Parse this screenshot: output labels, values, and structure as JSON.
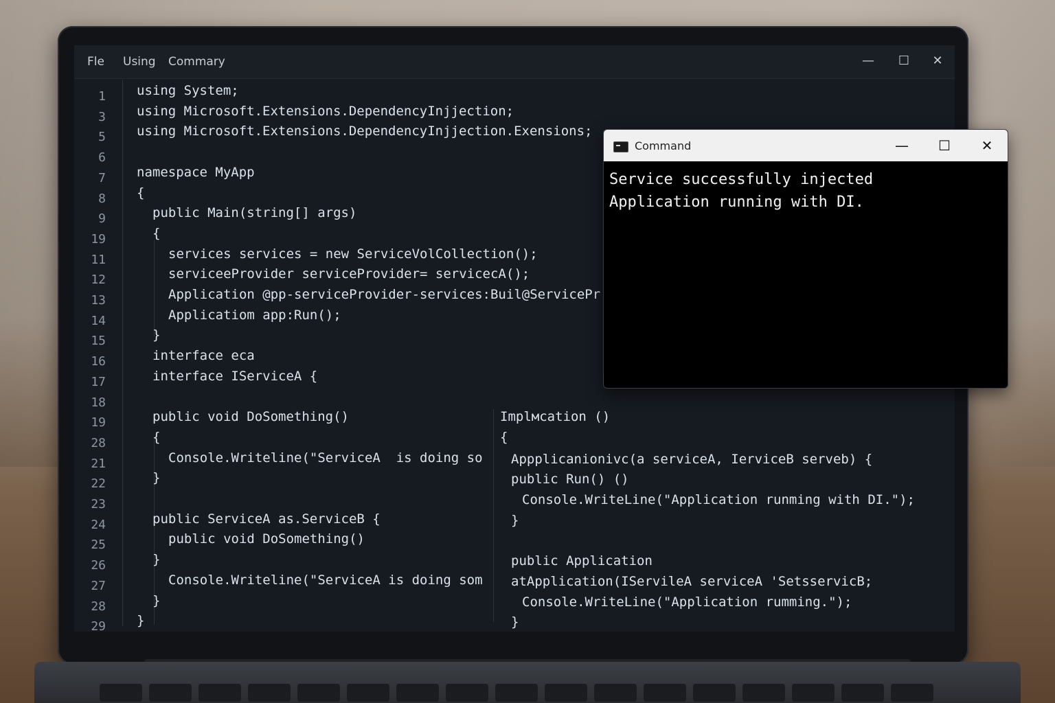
{
  "editor": {
    "menu": [
      "Fle",
      "Using",
      "Commary"
    ],
    "window_controls": [
      "minimize",
      "maximize",
      "close"
    ],
    "line_numbers": [
      "1",
      "3",
      "5",
      "6",
      "7",
      "8",
      "9",
      "19",
      "11",
      "12",
      "13",
      "14",
      "15",
      "16",
      "17",
      "18",
      "19",
      "28",
      "21",
      "22",
      "23",
      "24",
      "25",
      "26",
      "27",
      "28",
      "29"
    ],
    "left_code": [
      {
        "indent": 0,
        "text": "using System;"
      },
      {
        "indent": 0,
        "text": "using Microsoft.Extensions.DependencyInjjection;"
      },
      {
        "indent": 0,
        "text": "using Microsoft.Extensions.DependencyInjjection.Exensions;"
      },
      {
        "indent": 0,
        "text": ""
      },
      {
        "indent": 0,
        "text": "namespace MyApp"
      },
      {
        "indent": 0,
        "text": "{"
      },
      {
        "indent": 1,
        "text": "public Main(string[] args)"
      },
      {
        "indent": 1,
        "text": "{"
      },
      {
        "indent": 2,
        "text": "services services = new ServiceVolCollection();"
      },
      {
        "indent": 2,
        "text": "serviceeProvider serviceProvider= servicecA();"
      },
      {
        "indent": 2,
        "text": "Application @pp-serviceProvider-services:Buil@ServicePr"
      },
      {
        "indent": 2,
        "text": "Applicatiom app:Run();"
      },
      {
        "indent": 1,
        "text": "}"
      },
      {
        "indent": 1,
        "text": "interface eca"
      },
      {
        "indent": 1,
        "text": "interface IServiceA {"
      },
      {
        "indent": 0,
        "text": ""
      },
      {
        "indent": 1,
        "text": "public void DoSomething()"
      },
      {
        "indent": 1,
        "text": "{"
      },
      {
        "indent": 2,
        "text": "Console.Writeline(\"ServiceA  is doing so"
      },
      {
        "indent": 1,
        "text": "}"
      },
      {
        "indent": 0,
        "text": ""
      },
      {
        "indent": 1,
        "text": "public ServiceA as.ServiceB {"
      },
      {
        "indent": 2,
        "text": "public void DoSomething()"
      },
      {
        "indent": 1,
        "text": "}"
      },
      {
        "indent": 2,
        "text": "Console.Writeline(\"ServiceA is doing som"
      },
      {
        "indent": 1,
        "text": "}"
      },
      {
        "indent": 0,
        "text": "}"
      }
    ],
    "right_code": [
      {
        "row": 16,
        "indent": 0,
        "text": "Implмcation ()"
      },
      {
        "row": 17,
        "indent": 0,
        "text": "{"
      },
      {
        "row": 18,
        "indent": 1,
        "text": "Appplicanionivc(a serviceA, IerviceB serveb) {"
      },
      {
        "row": 19,
        "indent": 1,
        "text": "public Run() ()"
      },
      {
        "row": 20,
        "indent": 2,
        "text": "Console.WriteLine(\"Application runming with DI.\");"
      },
      {
        "row": 21,
        "indent": 1,
        "text": "}"
      },
      {
        "row": 23,
        "indent": 1,
        "text": "public Application"
      },
      {
        "row": 24,
        "indent": 1,
        "text": "atApplication(IServileA serviceA 'SetsservicB;"
      },
      {
        "row": 25,
        "indent": 2,
        "text": "Console.WriteLine(\"Application rumming.\");"
      },
      {
        "row": 26,
        "indent": 1,
        "text": "}"
      }
    ]
  },
  "command_window": {
    "title": "Command",
    "icon": "console-icon",
    "output": [
      "Service successfully injected",
      "Application running with DI."
    ]
  },
  "colors": {
    "editor_bg": "#161b22",
    "code_text": "#dbe2ea",
    "keyword": "#a9c6e8",
    "cmd_bg": "#000000",
    "cmd_titlebar": "#f0f0f0"
  }
}
